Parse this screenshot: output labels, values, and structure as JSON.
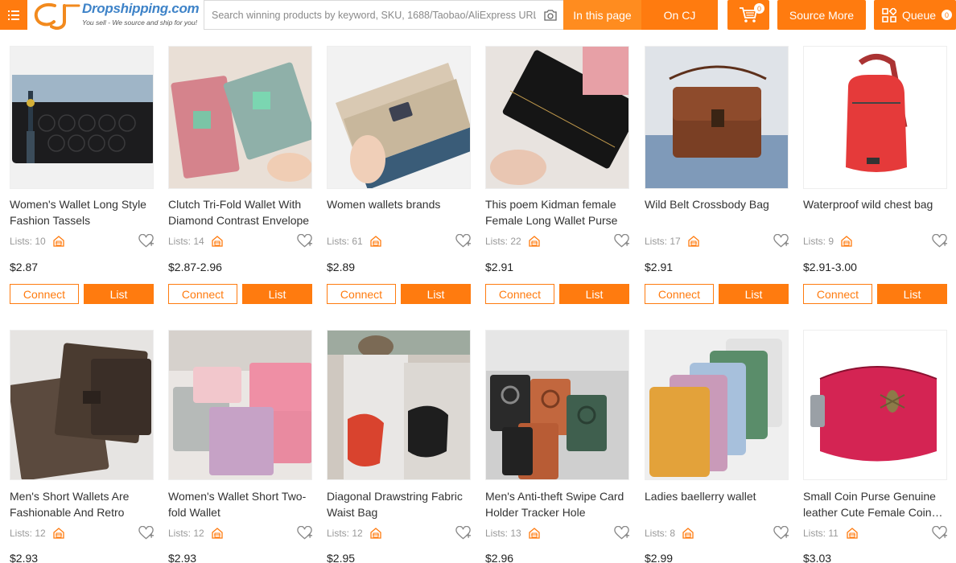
{
  "header": {
    "logo_text": "Dropshipping.com",
    "logo_tagline": "You sell - We source and ship for you!",
    "search_placeholder": "Search winning products by keyword, SKU, 1688/Taobao/AliExpress URL",
    "in_this_page": "In this page",
    "on_cj": "On CJ",
    "cart_count": "0",
    "source_more": "Source More",
    "queue_label": "Queue",
    "queue_count": "0",
    "accent_color": "#ff7b0f"
  },
  "card_buttons": {
    "connect": "Connect",
    "list": "List"
  },
  "products_row1": [
    {
      "title": "Women's Wallet Long Style Fashion Tassels",
      "lists": "Lists: 10",
      "price": "$2.87",
      "image": "black-and-blue-long-wallet-with-tassel"
    },
    {
      "title": "Clutch Tri-Fold Wallet With Diamond Contrast Envelope",
      "lists": "Lists: 14",
      "price": "$2.87-2.96",
      "image": "floral-trifold-wallets-in-hand"
    },
    {
      "title": "Women wallets brands",
      "lists": "Lists: 61",
      "price": "$2.89",
      "image": "beige-envelope-wallet-with-mandala-print"
    },
    {
      "title": "This poem Kidman female Female Long Wallet Purse",
      "lists": "Lists: 22",
      "price": "$2.91",
      "image": "black-long-wallet-in-hand"
    },
    {
      "title": "Wild Belt Crossbody Bag",
      "lists": "Lists: 17",
      "price": "$2.91",
      "image": "brown-leather-crossbody-bag"
    },
    {
      "title": "Waterproof wild chest bag",
      "lists": "Lists: 9",
      "price": "$2.91-3.00",
      "image": "red-sling-chest-bag"
    }
  ],
  "products_row2": [
    {
      "title": "Men's Short Wallets Are Fashionable And Retro",
      "lists": "Lists: 12",
      "price": "$2.93",
      "image": "brown-short-mens-wallets"
    },
    {
      "title": "Women's Wallet Short Two-fold Wallet",
      "lists": "Lists: 12",
      "price": "$2.93",
      "image": "pastel-short-bifold-wallets"
    },
    {
      "title": "Diagonal Drawstring Fabric Waist Bag",
      "lists": "Lists: 12",
      "price": "$2.95",
      "image": "couple-wearing-drawstring-waist-bags"
    },
    {
      "title": "Men's Anti-theft Swipe Card Holder Tracker Hole",
      "lists": "Lists: 13",
      "price": "$2.96",
      "image": "card-holders-with-tracker-hole"
    },
    {
      "title": "Ladies baellerry wallet",
      "lists": "Lists: 8",
      "price": "$2.99",
      "image": "colorful-phone-wallets"
    },
    {
      "title": "Small Coin Purse Genuine leather Cute Female Coin Purse",
      "lists": "Lists: 11",
      "price": "$3.03",
      "image": "red-leather-coin-purse-with-bee"
    }
  ]
}
